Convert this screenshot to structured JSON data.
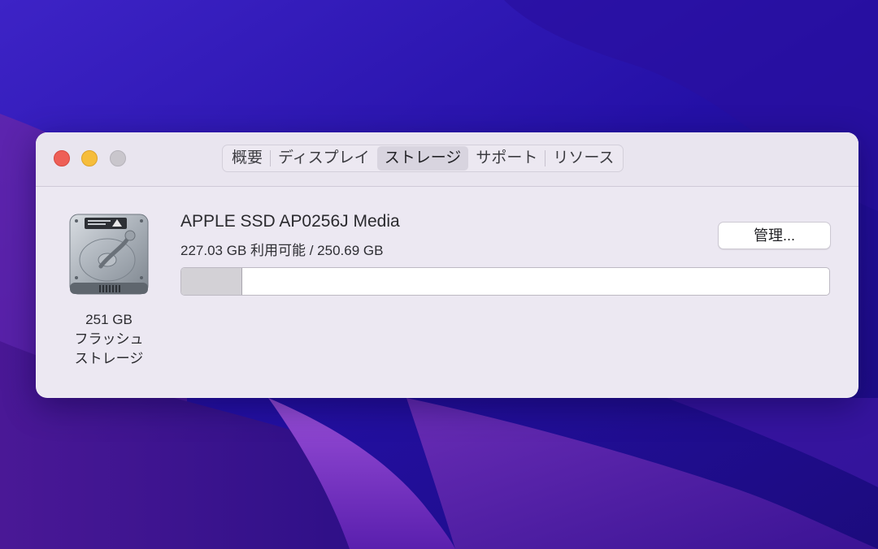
{
  "tabs": [
    {
      "label": "概要",
      "active": false
    },
    {
      "label": "ディスプレイ",
      "active": false
    },
    {
      "label": "ストレージ",
      "active": true
    },
    {
      "label": "サポート",
      "active": false
    },
    {
      "label": "リソース",
      "active": false
    }
  ],
  "disk": {
    "name": "APPLE SSD AP0256J Media",
    "available_text": "227.03 GB 利用可能 / 250.69 GB",
    "available_gb": 227.03,
    "total_gb": 250.69,
    "used_fraction": 0.094,
    "caption_lines": [
      "251 GB",
      "フラッシュ",
      "ストレージ"
    ],
    "icon": "internal-drive-icon"
  },
  "manage_button_label": "管理...",
  "colors": {
    "close": "#ee5f57",
    "minimize": "#f6bd3b",
    "zoom": "#c9c6cc",
    "used_segment": "#d3d1d6"
  }
}
